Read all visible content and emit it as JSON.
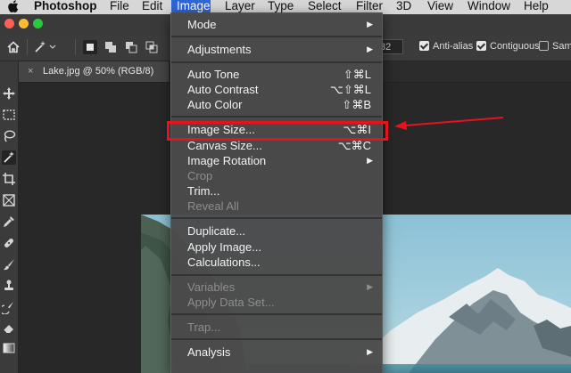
{
  "menubar": {
    "app_name": "Photoshop",
    "items": [
      "File",
      "Edit",
      "Image",
      "Layer",
      "Type",
      "Select",
      "Filter",
      "3D",
      "View",
      "Window",
      "Help"
    ],
    "active_item": "Image"
  },
  "options_bar": {
    "tolerance_value": "32",
    "anti_alias_label": "Anti-alias",
    "anti_alias_checked": true,
    "contiguous_label": "Contiguous",
    "contiguous_checked": true,
    "sample_label": "Samp",
    "sample_checked": false
  },
  "document": {
    "tab_title": "Lake.jpg @ 50% (RGB/8)",
    "close_glyph": "×"
  },
  "image_menu": {
    "mode": {
      "label": "Mode",
      "submenu": true
    },
    "adjustments": {
      "label": "Adjustments",
      "submenu": true
    },
    "auto_tone": {
      "label": "Auto Tone",
      "shortcut": "⇧⌘L"
    },
    "auto_contrast": {
      "label": "Auto Contrast",
      "shortcut": "⌥⇧⌘L"
    },
    "auto_color": {
      "label": "Auto Color",
      "shortcut": "⇧⌘B"
    },
    "image_size": {
      "label": "Image Size...",
      "shortcut": "⌥⌘I"
    },
    "canvas_size": {
      "label": "Canvas Size...",
      "shortcut": "⌥⌘C"
    },
    "image_rotation": {
      "label": "Image Rotation",
      "submenu": true
    },
    "crop": {
      "label": "Crop",
      "disabled": true
    },
    "trim": {
      "label": "Trim..."
    },
    "reveal_all": {
      "label": "Reveal All",
      "disabled": true
    },
    "duplicate": {
      "label": "Duplicate..."
    },
    "apply_image": {
      "label": "Apply Image..."
    },
    "calculations": {
      "label": "Calculations..."
    },
    "variables": {
      "label": "Variables",
      "submenu": true,
      "disabled": true
    },
    "apply_data_set": {
      "label": "Apply Data Set...",
      "disabled": true
    },
    "trap": {
      "label": "Trap...",
      "disabled": true
    },
    "analysis": {
      "label": "Analysis",
      "submenu": true
    }
  },
  "glyphs": {
    "submenu_arrow": "▶"
  },
  "colors": {
    "menubar_active": "#2e67d6",
    "menu_background": "#4a4a4a",
    "annotation_red": "#e8121c",
    "light_close": "#ff5f57",
    "light_minimize": "#febc2e",
    "light_zoom": "#28c840"
  },
  "icons": {
    "menubar": "apple-logo-icon",
    "options_bar": [
      "home-icon",
      "magic-wand-icon",
      "new-selection-icon",
      "add-to-selection-icon",
      "subtract-from-selection-icon",
      "intersect-selection-icon"
    ],
    "toolbar": [
      "move-icon",
      "marquee-icon",
      "lasso-icon",
      "magic-wand-icon",
      "crop-icon",
      "frame-icon",
      "eyedropper-icon",
      "healing-brush-icon",
      "brush-icon",
      "clone-stamp-icon",
      "history-brush-icon",
      "eraser-icon",
      "gradient-icon"
    ]
  }
}
